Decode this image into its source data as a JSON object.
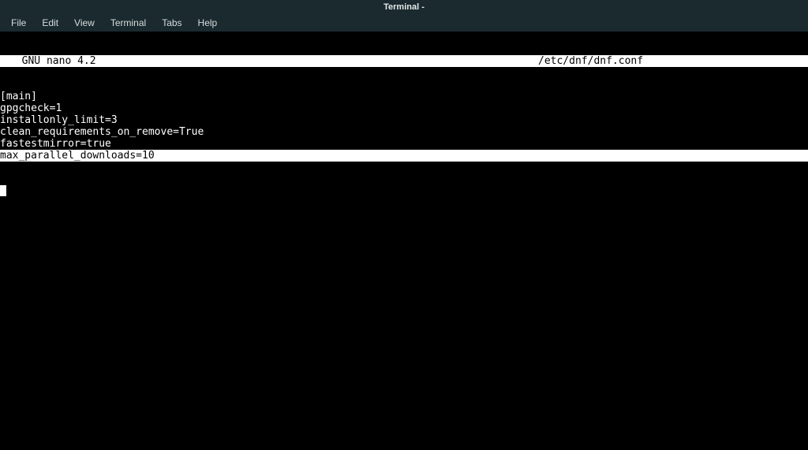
{
  "window": {
    "title": "Terminal -"
  },
  "menubar": {
    "items": [
      "File",
      "Edit",
      "View",
      "Terminal",
      "Tabs",
      "Help"
    ]
  },
  "nano": {
    "app_name": "  GNU nano 4.2",
    "file_path": "/etc/dnf/dnf.conf",
    "lines": [
      "[main]",
      "gpgcheck=1",
      "installonly_limit=3",
      "clean_requirements_on_remove=True",
      "fastestmirror=true",
      "max_parallel_downloads=10"
    ],
    "highlight_index": 5
  }
}
